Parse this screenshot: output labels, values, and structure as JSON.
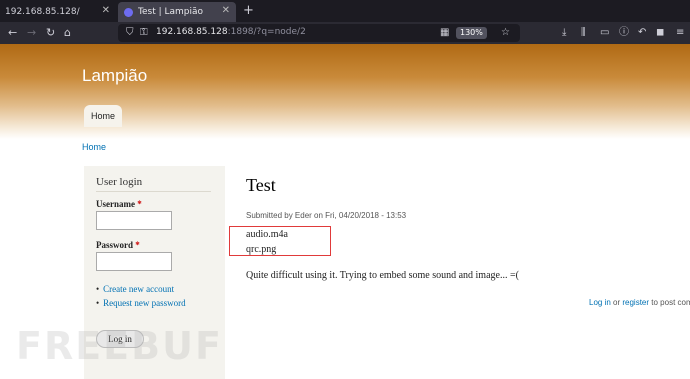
{
  "browser": {
    "tabs": [
      {
        "title": "192.168.85.128/",
        "active": false
      },
      {
        "title": "Test | Lampião",
        "active": true
      }
    ],
    "new_tab": "+",
    "url_host": "192.168.85.128",
    "url_rest": ":1898/?q=node/2",
    "zoom": "130%"
  },
  "site": {
    "name": "Lampião",
    "nav_home": "Home",
    "breadcrumb_home": "Home"
  },
  "login": {
    "title": "User login",
    "username_label": "Username",
    "password_label": "Password",
    "required_mark": "*",
    "create_account": "Create new account",
    "request_password": "Request new password",
    "submit": "Log in"
  },
  "node": {
    "title": "Test",
    "submitted": "Submitted by Eder on Fri, 04/20/2018 - 13:53",
    "attachments": [
      "audio.m4a",
      "qrc.png"
    ],
    "body": "Quite difficult using it. Trying to embed some sound and image... =(",
    "links_login": "Log in",
    "links_or": " or ",
    "links_register": "register",
    "links_suffix": " to post com"
  },
  "watermark": "FREEBUF",
  "colors": {
    "link": "#0071b3",
    "highlight_border": "#e03a3a",
    "header_top": "#b06a14"
  }
}
